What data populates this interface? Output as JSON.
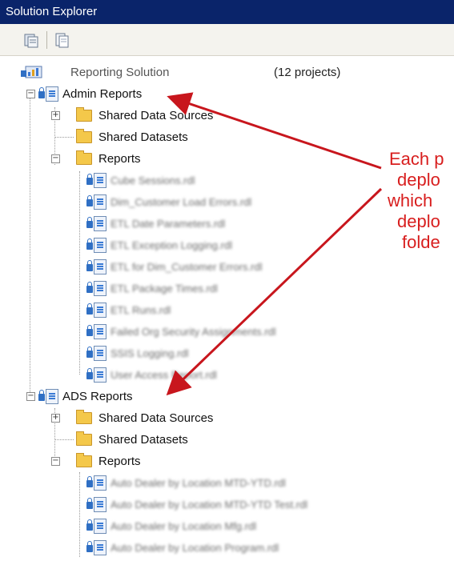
{
  "window": {
    "title": "Solution Explorer"
  },
  "toolbar": {
    "buttons": [
      "properties-icon",
      "show-all-files-icon"
    ]
  },
  "solution": {
    "label": "Reporting Solution",
    "count": "(12 projects)"
  },
  "admin": {
    "label": "Admin Reports",
    "shared_sources": "Shared Data Sources",
    "shared_datasets": "Shared Datasets",
    "reports": "Reports",
    "files": [
      "Cube Sessions.rdl",
      "Dim_Customer Load Errors.rdl",
      "ETL Date Parameters.rdl",
      "ETL Exception Logging.rdl",
      "ETL for Dim_Customer Errors.rdl",
      "ETL Package Times.rdl",
      "ETL Runs.rdl",
      "Failed Org Security Assignments.rdl",
      "SSIS Logging.rdl",
      "User Access Report.rdl"
    ]
  },
  "ads": {
    "label": "ADS Reports",
    "shared_sources": "Shared Data Sources",
    "shared_datasets": "Shared Datasets",
    "reports": "Reports",
    "files": [
      "Auto Dealer by Location MTD-YTD.rdl",
      "Auto Dealer by Location MTD-YTD Test.rdl",
      "Auto Dealer by Location Mfg.rdl",
      "Auto Dealer by Location Program.rdl"
    ]
  },
  "callout": {
    "line1": "Each p",
    "line2": "deplo",
    "line3": "which",
    "line4": "deplo",
    "line5": "folde",
    "color": "#d81e1e"
  }
}
